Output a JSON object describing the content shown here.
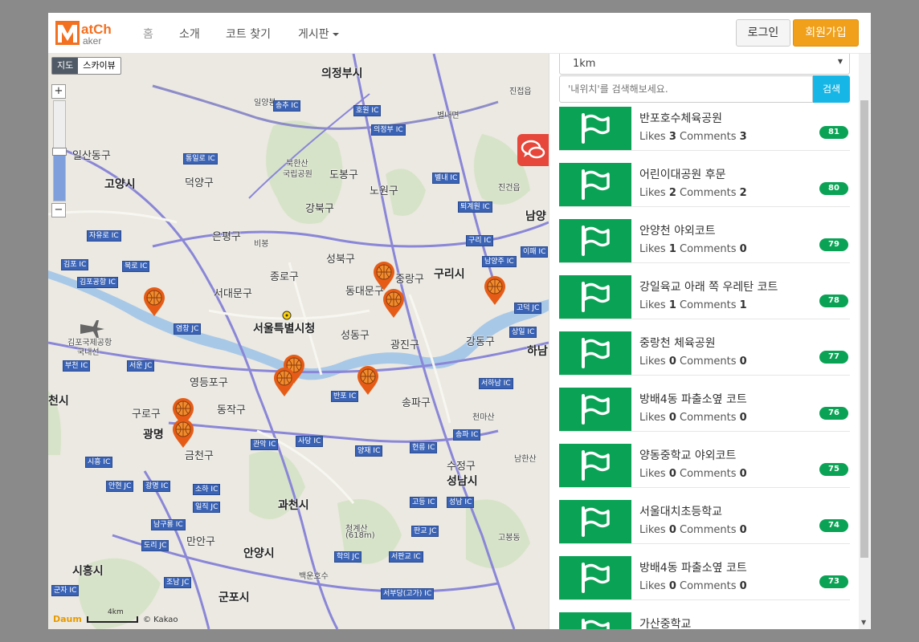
{
  "navbar": {
    "logo_text": "Match Maker",
    "items": [
      {
        "label": "홈"
      },
      {
        "label": "소개"
      },
      {
        "label": "코트 찾기"
      },
      {
        "label": "게시판"
      }
    ],
    "login_label": "로그인",
    "signup_label": "회원가입"
  },
  "map": {
    "type_buttons": [
      "지도",
      "스카이뷰"
    ],
    "zoom_in": "+",
    "zoom_out": "−",
    "zoom_level_fraction": 0.5,
    "scale_label": "4km",
    "brand": "Daum",
    "copyright": "© Kakao",
    "labels": {
      "uijeongbu": "의정부시",
      "goyang": "고양시",
      "ilsandong": "일산동구",
      "deogyang": "덕양구",
      "dobong": "도봉구",
      "nowon": "노원구",
      "gangbuk": "강북구",
      "eunpyeong": "은평구",
      "seongbuk": "성북구",
      "jongno": "종로구",
      "seodaemun": "서대문구",
      "dongdaemun": "동대문구",
      "jungnang": "중랑구",
      "guri": "구리시",
      "namyang": "남양",
      "seoul_city_hall": "서울특별시청",
      "seongdong": "성동구",
      "gwangjin": "광진구",
      "gangdong": "강동구",
      "hanam": "하남",
      "gimpo_airport": "김포국제공항",
      "domestic": "국내선",
      "yeongdeungpo": "영등포구",
      "dongjak": "동작구",
      "songpa": "송파구",
      "guro": "구로구",
      "gwangmyeong": "광명",
      "geumcheon": "금천구",
      "gwacheon": "과천시",
      "sujeong": "수정구",
      "seongnam": "성남시",
      "anyang": "안양시",
      "manan": "만안구",
      "siheung": "시흥시",
      "gunpo": "군포시",
      "cheongye": "청계산",
      "cheongye_h": "(618m)",
      "bukhansan": "북한산",
      "gukripgongwon": "국립공원",
      "jinjeop": "진접읍",
      "jingeon": "진건읍",
      "byeolnae": "별내면",
      "bibong": "비봉",
      "cheonmasan": "천마산",
      "baegunhosu": "백운호수",
      "namhansan": "남한산",
      "gobaeuldong": "고봉동",
      "cheonsi": "천시",
      "ilyangbong": "일양봉"
    },
    "ic_labels": {
      "songchu": "송추 IC",
      "hoyong": "호원 IC",
      "uijeongbu_ic": "의정부 IC",
      "tongil": "통일로 IC",
      "jayu": "자유로 IC",
      "gimpo": "김포 IC",
      "gimpo_airport": "김포공항 IC",
      "bukbu": "북로 IC",
      "yeomchang": "염창 JC",
      "bucheon": "부천 IC",
      "seoun": "서운 JC",
      "sihung": "시흥 IC",
      "ansan": "안현 JC",
      "gwangmyeong": "광명 IC",
      "doriul": "도리 JC",
      "jorwon": "조남 JC",
      "gunja": "군자 IC",
      "ilsan": "일직 JC",
      "soha": "소하 IC",
      "gwanak": "관악 IC",
      "sadang": "사당 IC",
      "banpo": "반포 IC",
      "yangjae": "양재 IC",
      "heolleung": "헌릉 IC",
      "songpa": "송파 IC",
      "sangil": "상일 IC",
      "seohanam": "서하남 IC",
      "guri": "구리 IC",
      "namyangju": "남양주 IC",
      "idong": "이패 IC",
      "toegyewon": "퇴계원 IC",
      "byeolnae": "별내 IC",
      "godeok": "고덕 JC",
      "pangyo": "판교 JC",
      "seongnam": "성남 IC",
      "godeung": "고등 IC",
      "hakui": "학의 JC",
      "seopangyo": "서판교 IC",
      "seochodang": "서부당(고가) IC",
      "namgureong": "남구룡 IC"
    }
  },
  "sidebar": {
    "radius_select": "1km",
    "search_placeholder": "'내위치'를 검색해보세요.",
    "search_button": "검색",
    "likes_word": "Likes",
    "comments_word": "Comments",
    "courts": [
      {
        "name": "반포호수체육공원",
        "likes": "3",
        "comments": "3",
        "badge": "81"
      },
      {
        "name": "어린이대공원 후문",
        "likes": "2",
        "comments": "2",
        "badge": "80"
      },
      {
        "name": "안양천 야외코트",
        "likes": "1",
        "comments": "0",
        "badge": "79"
      },
      {
        "name": "강일육교 아래 쪽 우레탄 코트",
        "likes": "1",
        "comments": "1",
        "badge": "78"
      },
      {
        "name": "중랑천 체육공원",
        "likes": "0",
        "comments": "0",
        "badge": "77"
      },
      {
        "name": "방배4동 파출소옆 코트",
        "likes": "0",
        "comments": "0",
        "badge": "76"
      },
      {
        "name": "양동중학교 야외코트",
        "likes": "0",
        "comments": "0",
        "badge": "75"
      },
      {
        "name": "서울대치초등학교",
        "likes": "0",
        "comments": "0",
        "badge": "74"
      },
      {
        "name": "방배4동 파출소옆 코트",
        "likes": "0",
        "comments": "0",
        "badge": "73"
      },
      {
        "name": "가산중학교",
        "likes": "",
        "comments": "",
        "badge": ""
      }
    ]
  }
}
